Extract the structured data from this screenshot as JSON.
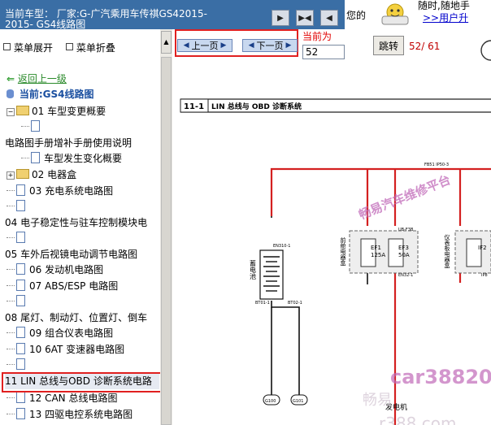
{
  "header": {
    "car_model_line1": "当前车型： 厂家:G-广汽乘用车传祺GS42015-",
    "car_model_line2": "2015-  GS4线路图",
    "greeting": "您的",
    "user_text": "随时,随地手",
    "user_link": ">>用户升"
  },
  "sidebar": {
    "expand_label": "菜单展开",
    "collapse_label": "菜单折叠",
    "back_label": "返回上一级",
    "current_label": "当前:GS4线路图",
    "items": [
      {
        "label": "01 车型变更概要"
      },
      {
        "label": ""
      },
      {
        "label": "电路图手册增补手册使用说明"
      },
      {
        "label": "车型发生变化概要"
      },
      {
        "label": "02 电器盒"
      },
      {
        "label": "03 充电系统电路图"
      },
      {
        "label": ""
      },
      {
        "label": "04 电子稳定性与驻车控制模块电"
      },
      {
        "label": ""
      },
      {
        "label": "05 车外后视镜电动调节电路图"
      },
      {
        "label": "06 发动机电路图"
      },
      {
        "label": "07 ABS/ESP 电路图"
      },
      {
        "label": ""
      },
      {
        "label": "08 尾灯、制动灯、位置灯、倒车"
      },
      {
        "label": "09 组合仪表电路图"
      },
      {
        "label": "10 6AT 变速器电路图"
      },
      {
        "label": ""
      },
      {
        "label": "11 LIN 总线与OBD 诊断系统电路"
      },
      {
        "label": "12 CAN 总线电路图"
      },
      {
        "label": "13 四驱电控系统电路图"
      }
    ]
  },
  "toolbar": {
    "prev_label": "上一页",
    "next_label": "下一页",
    "current_page_label": "当前为",
    "page_value": "52",
    "jump_label": "跳转",
    "page_count": "52/ 61"
  },
  "diagram": {
    "section_no": "11-1",
    "section_title": "LIN 总线与 OBD 诊断系统",
    "battery_label": "蓄电池",
    "engine_box_label": "前舱电器盒",
    "fuse1_name": "EF1",
    "fuse1_amp": "125A",
    "fuse2_name": "EF3",
    "fuse2_amp": "50A",
    "instr_box_label": "仪表板电器盒",
    "fuse3_name": "IF2",
    "generator_label": "发电机",
    "ground1": "G100",
    "ground2": "G101",
    "conn1": "EN310-1",
    "conn2": "BT01-1",
    "conn3": "BT02-1",
    "conn4": "FB51 IP50-3",
    "conn5": "UB-F3B",
    "conn6": "EN32-1",
    "conn7": "IP8",
    "watermark1": "畅易汽车维修平台",
    "watermark2": "car38820",
    "watermark3": "畅易",
    "watermark4": "r388.com"
  },
  "colors": {
    "header_bg": "#3a6ea5",
    "highlight_border": "#e02020",
    "page_text": "#c00000",
    "wire_red": "#d42020",
    "watermark": "#c06ab8"
  }
}
